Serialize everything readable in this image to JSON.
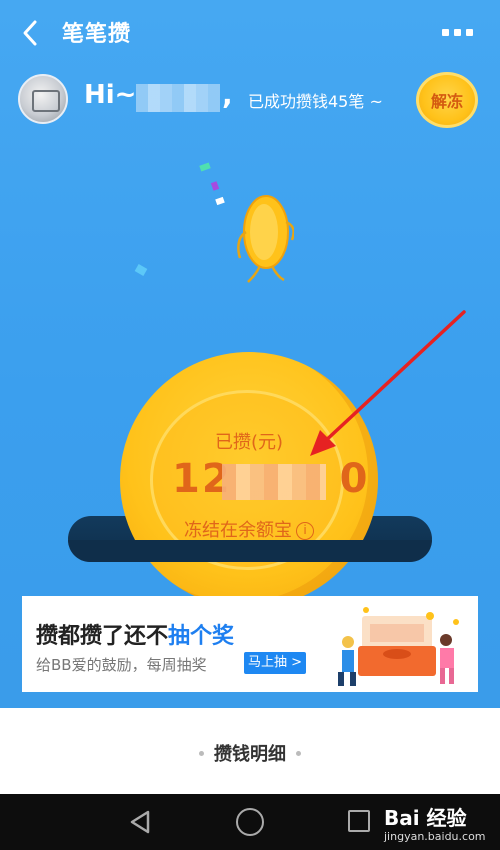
{
  "header": {
    "title": "笔笔攒"
  },
  "user": {
    "greeting": "Hi~",
    "comma": ",",
    "saved_count_text": "已成功攒钱45笔 ~",
    "unfreeze_label": "解冻"
  },
  "coin": {
    "saved_label": "已攒(元)",
    "amount_prefix": "12",
    "amount_suffix": "0",
    "frozen_note": "冻结在余额宝",
    "info_glyph": "i"
  },
  "banner": {
    "title_prefix": "攒都攒了还不",
    "title_highlight": "抽个奖",
    "subtitle": "给BB爱的鼓励，每周抽奖",
    "button_label": "马上抽 >"
  },
  "details": {
    "title": "攒钱明细"
  },
  "watermark": {
    "brand": "Bai 经验",
    "url": "jingyan.baidu.com"
  },
  "colors": {
    "primary_blue": "#3b9fee",
    "coin_gold": "#ffc21a",
    "coin_text": "#e0661a",
    "accent_blue": "#1e7ff0",
    "annotation_red": "#e62222"
  },
  "icons": {
    "back": "chevron-left-icon",
    "more": "more-dots-icon",
    "info": "info-icon",
    "nav_back": "triangle-back-icon",
    "nav_home": "circle-home-icon",
    "nav_recent": "square-recent-icon"
  }
}
